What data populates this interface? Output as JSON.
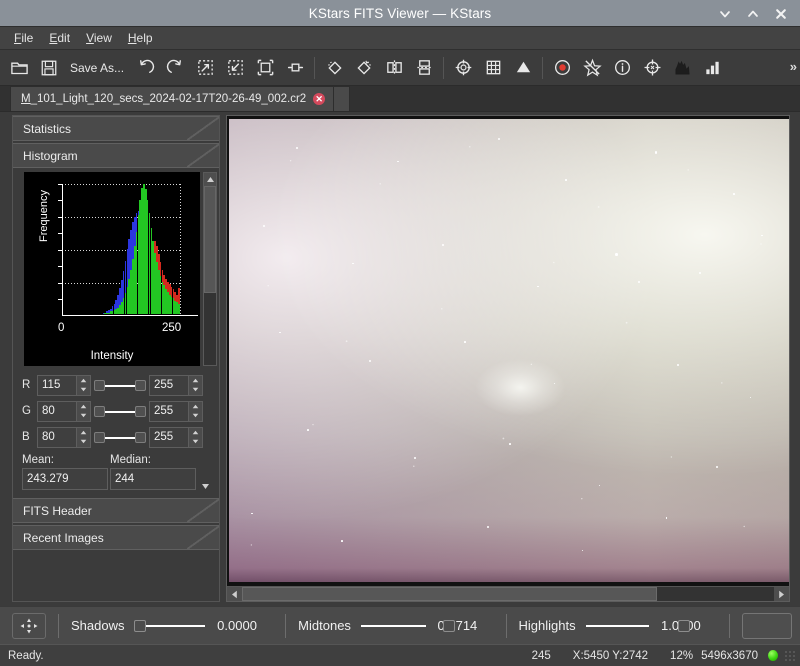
{
  "window": {
    "title": "KStars FITS Viewer — KStars",
    "controls": [
      {
        "name": "minimize-button",
        "glyph": "⌄"
      },
      {
        "name": "maximize-button",
        "glyph": "⌃"
      },
      {
        "name": "close-button",
        "glyph": "✕"
      }
    ]
  },
  "menubar": {
    "items": [
      {
        "label": "File",
        "accel": "F"
      },
      {
        "label": "Edit",
        "accel": "E"
      },
      {
        "label": "View",
        "accel": "V"
      },
      {
        "label": "Help",
        "accel": "H"
      }
    ]
  },
  "toolbar": {
    "open_label": "",
    "save_as_label": "Save As...",
    "overflow_label": "»",
    "items": [
      {
        "name": "open-folder-icon",
        "icon": "folder"
      },
      {
        "name": "save-icon",
        "icon": "floppy"
      },
      {
        "name": "save-as-button",
        "icon": "text",
        "label": "Save As..."
      },
      {
        "name": "undo-icon",
        "icon": "undo"
      },
      {
        "name": "redo-icon",
        "icon": "redo"
      },
      {
        "name": "zoom-in-icon",
        "icon": "zoom-in"
      },
      {
        "name": "zoom-out-icon",
        "icon": "zoom-out"
      },
      {
        "name": "zoom-fit-icon",
        "icon": "zoom-fit"
      },
      {
        "name": "zoom-default-icon",
        "icon": "zoom-default"
      },
      {
        "name": "rotate-right-icon",
        "icon": "rotate-cw"
      },
      {
        "name": "rotate-left-icon",
        "icon": "rotate-ccw"
      },
      {
        "name": "flip-horizontal-icon",
        "icon": "flip-h"
      },
      {
        "name": "flip-vertical-icon",
        "icon": "flip-v"
      },
      {
        "name": "crosshair-icon",
        "icon": "crosshair"
      },
      {
        "name": "grid-icon",
        "icon": "grid"
      },
      {
        "name": "peak-icon",
        "icon": "peak"
      },
      {
        "name": "record-icon",
        "icon": "record"
      },
      {
        "name": "star-detect-icon",
        "icon": "star-detect"
      },
      {
        "name": "info-icon",
        "icon": "info"
      },
      {
        "name": "target-icon",
        "icon": "target"
      },
      {
        "name": "histogram-curve-icon",
        "icon": "hist-curve"
      },
      {
        "name": "statistics-bars-icon",
        "icon": "bars"
      }
    ]
  },
  "tabs": [
    {
      "label": "M_101_Light_120_secs_2024-02-17T20-26-49_002.cr2",
      "accel_prefix": "M",
      "rest": "_101_Light_120_secs_2024-02-17T20-26-49_002.cr2",
      "close_glyph": "✕",
      "active": true
    }
  ],
  "sidebar": {
    "sections": [
      {
        "name": "sidebar-section-statistics",
        "label": "Statistics"
      },
      {
        "name": "sidebar-section-histogram",
        "label": "Histogram"
      },
      {
        "name": "sidebar-section-fits-header",
        "label": "FITS Header"
      },
      {
        "name": "sidebar-section-recent-images",
        "label": "Recent Images"
      }
    ],
    "channels": [
      {
        "name": "R",
        "low": "115",
        "high": "255"
      },
      {
        "name": "G",
        "low": "80",
        "high": "255"
      },
      {
        "name": "B",
        "low": "80",
        "high": "255"
      }
    ],
    "stats": {
      "mean_label": "Mean:",
      "mean_value": "243.279",
      "median_label": "Median:",
      "median_value": "244"
    }
  },
  "chart_data": {
    "type": "bar",
    "title": "Histogram",
    "xlabel": "Intensity",
    "ylabel": "Frequency",
    "xlim": [
      0,
      255
    ],
    "ylim": [
      0,
      100
    ],
    "xticks": [
      "0",
      "250"
    ],
    "grid": true,
    "legend": "none",
    "x": [
      0,
      4,
      8,
      12,
      16,
      20,
      24,
      28,
      32,
      36,
      40,
      44,
      48,
      52,
      56,
      60,
      64,
      68,
      72,
      76,
      80,
      84,
      88,
      92,
      96,
      100,
      104,
      108,
      112,
      116,
      120,
      124,
      128,
      132,
      136,
      140,
      144,
      148,
      152,
      156,
      160,
      164,
      168,
      172,
      176,
      180,
      184,
      188,
      192,
      196,
      200,
      204,
      208,
      212,
      216,
      220,
      224,
      228,
      232,
      236,
      240,
      244,
      248,
      252
    ],
    "series": [
      {
        "name": "Red",
        "color": "#d42a1e",
        "values": [
          0,
          0,
          0,
          0,
          0,
          0,
          0,
          0,
          0,
          0,
          0,
          0,
          0,
          0,
          0,
          0,
          0,
          0,
          0,
          0,
          0,
          0,
          0,
          0,
          0,
          1,
          1,
          1,
          2,
          2,
          3,
          3,
          4,
          5,
          6,
          8,
          10,
          13,
          16,
          19,
          22,
          26,
          30,
          34,
          38,
          42,
          46,
          50,
          54,
          56,
          56,
          52,
          46,
          40,
          34,
          30,
          27,
          25,
          23,
          21,
          19,
          17,
          15,
          20
        ]
      },
      {
        "name": "Green",
        "color": "#23c723",
        "values": [
          0,
          0,
          0,
          0,
          0,
          0,
          0,
          0,
          0,
          0,
          0,
          0,
          0,
          0,
          0,
          0,
          0,
          0,
          0,
          0,
          0,
          0,
          0,
          1,
          1,
          1,
          2,
          2,
          3,
          4,
          5,
          7,
          9,
          12,
          16,
          21,
          27,
          34,
          42,
          52,
          63,
          76,
          88,
          97,
          100,
          96,
          88,
          78,
          66,
          56,
          47,
          40,
          34,
          29,
          25,
          22,
          19,
          17,
          15,
          13,
          12,
          10,
          9,
          8
        ]
      },
      {
        "name": "Blue",
        "color": "#2b35e0",
        "values": [
          0,
          0,
          0,
          0,
          0,
          0,
          0,
          0,
          0,
          0,
          0,
          0,
          0,
          0,
          0,
          0,
          0,
          0,
          0,
          0,
          0,
          0,
          1,
          1,
          2,
          3,
          4,
          6,
          8,
          11,
          15,
          20,
          26,
          33,
          41,
          50,
          58,
          65,
          71,
          75,
          78,
          79,
          77,
          72,
          65,
          57,
          49,
          41,
          34,
          28,
          23,
          19,
          16,
          13,
          11,
          9,
          8,
          7,
          6,
          5,
          5,
          4,
          4,
          3
        ]
      }
    ]
  },
  "stretch_toolbar": {
    "autostretch_icon": "move-crosshair-icon",
    "controls": [
      {
        "name": "shadows",
        "label": "Shadows",
        "value": "0.0000",
        "fraction": 0.0
      },
      {
        "name": "midtones",
        "label": "Midtones",
        "value": "0.8714",
        "fraction": 0.8714
      },
      {
        "name": "highlights",
        "label": "Highlights",
        "value": "1.0000",
        "fraction": 1.0
      }
    ],
    "swatch_name": "stretch-preview-swatch"
  },
  "statusbar": {
    "message": "Ready.",
    "pixel_value": "245",
    "coordinates": "X:5450 Y:2742",
    "zoom": "12%",
    "resolution": "5496x3670",
    "led_color": "#3cd510"
  }
}
